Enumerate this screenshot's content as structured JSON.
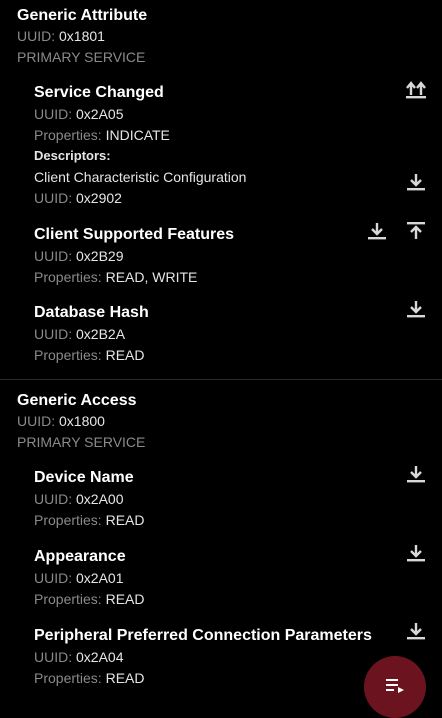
{
  "services": [
    {
      "name": "Generic Attribute",
      "uuid_label": "UUID:",
      "uuid": "0x1801",
      "type": "PRIMARY SERVICE",
      "characteristics": [
        {
          "name": "Service Changed",
          "uuid_label": "UUID:",
          "uuid": "0x2A05",
          "props_label": "Properties:",
          "props": "INDICATE",
          "descriptors_header": "Descriptors:",
          "descriptor_name": "Client Characteristic Configuration",
          "descriptor_uuid_label": "UUID:",
          "descriptor_uuid": "0x2902"
        },
        {
          "name": "Client Supported Features",
          "uuid_label": "UUID:",
          "uuid": "0x2B29",
          "props_label": "Properties:",
          "props": "READ, WRITE"
        },
        {
          "name": "Database Hash",
          "uuid_label": "UUID:",
          "uuid": "0x2B2A",
          "props_label": "Properties:",
          "props": "READ"
        }
      ]
    },
    {
      "name": "Generic Access",
      "uuid_label": "UUID:",
      "uuid": "0x1800",
      "type": "PRIMARY SERVICE",
      "characteristics": [
        {
          "name": "Device Name",
          "uuid_label": "UUID:",
          "uuid": "0x2A00",
          "props_label": "Properties:",
          "props": "READ"
        },
        {
          "name": "Appearance",
          "uuid_label": "UUID:",
          "uuid": "0x2A01",
          "props_label": "Properties:",
          "props": "READ"
        },
        {
          "name": "Peripheral Preferred Connection Parameters",
          "uuid_label": "UUID:",
          "uuid": "0x2A04",
          "props_label": "Properties:",
          "props": "READ"
        }
      ]
    }
  ],
  "colors": {
    "background": "#000000",
    "fab": "#6b1420",
    "secondary_text": "#8a8a8a"
  },
  "icons": [
    "indicate-icon",
    "download-icon",
    "upload-icon",
    "menu-list-icon"
  ]
}
